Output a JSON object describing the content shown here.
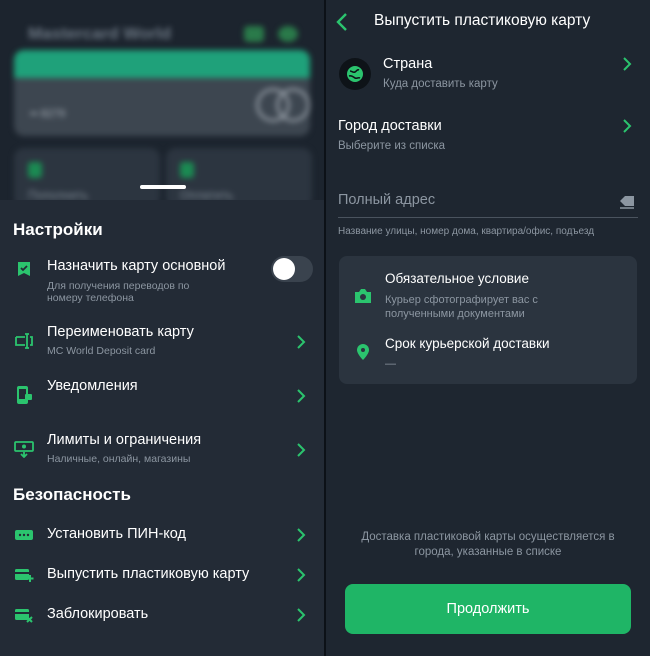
{
  "colors": {
    "accent": "#1fb566",
    "icon_green": "#2bc46e",
    "panel_left": "#232b36",
    "panel_right": "#1e2630",
    "muted": "#8c96a1"
  },
  "left": {
    "blurred": {
      "card_name": "Mastercard World",
      "card_number": "•• 8279",
      "tile_1_label": "Пополнить",
      "tile_2_label": "Оплатить"
    },
    "settings": {
      "title": "Настройки",
      "items": [
        {
          "icon": "card-check-icon",
          "label": "Назначить карту основной",
          "sub": "Для получения переводов по номеру телефона",
          "sub_line1": "Для получения переводов по",
          "sub_line2": "номеру телефона",
          "control": "toggle",
          "toggle_on": false
        },
        {
          "icon": "rename-card-icon",
          "label": "Переименовать карту",
          "sub": "MC World Deposit card",
          "control": "chevron"
        },
        {
          "icon": "phone-notification-icon",
          "label": "Уведомления",
          "sub": "",
          "control": "chevron"
        },
        {
          "icon": "limits-icon",
          "label": "Лимиты и ограничения",
          "sub": "Наличные, онлайн, магазины",
          "control": "chevron"
        }
      ]
    },
    "security": {
      "title": "Безопасность",
      "items": [
        {
          "icon": "pin-code-icon",
          "label": "Установить ПИН-код",
          "control": "chevron"
        },
        {
          "icon": "add-card-icon",
          "label": "Выпустить пластиковую карту",
          "control": "chevron"
        },
        {
          "icon": "block-card-icon",
          "label": "Заблокировать",
          "control": "chevron"
        }
      ]
    }
  },
  "right": {
    "header": {
      "title": "Выпустить пластиковую карту"
    },
    "country": {
      "label": "Страна",
      "sub": "Куда доставить карту"
    },
    "city": {
      "label": "Город доставки",
      "sub": "Выберите из списка"
    },
    "address": {
      "placeholder": "Полный адрес",
      "value": "",
      "hint": "Название улицы, номер дома, квартира/офис, подъезд"
    },
    "info": {
      "condition_title": "Обязательное условие",
      "condition_sub": "Курьер сфотографирует вас с полученными документами",
      "condition_sub_line1": "Курьер сфотографирует вас с",
      "condition_sub_line2": "полученными документами",
      "term_title": "Срок курьерской доставки",
      "term_value": "—"
    },
    "note": "Доставка пластиковой карты осуществляется в города, указанные в списке",
    "note_line1": "Доставка пластиковой карты осуществляется в",
    "note_line2": "города, указанные в списке",
    "continue_label": "Продолжить"
  }
}
